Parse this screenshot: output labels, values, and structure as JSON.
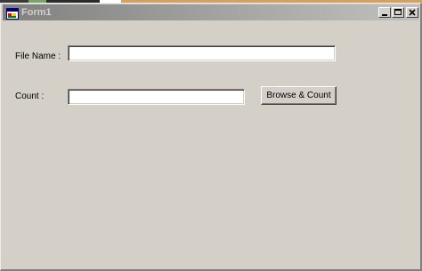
{
  "window": {
    "title": "Form1",
    "icon": "form-app-icon",
    "controls": {
      "minimize_icon": "minimize-icon",
      "maximize_icon": "maximize-icon",
      "close_icon": "close-icon"
    }
  },
  "form": {
    "file_name_label": "File Name :",
    "file_name_value": "",
    "count_label": "Count :",
    "count_value": "",
    "browse_button_label": "Browse & Count"
  },
  "colors": {
    "window_face": "#d4d0c8",
    "titlebar_inactive_start": "#808080",
    "titlebar_inactive_end": "#c0c0c0",
    "title_text": "#d4d0c8"
  }
}
